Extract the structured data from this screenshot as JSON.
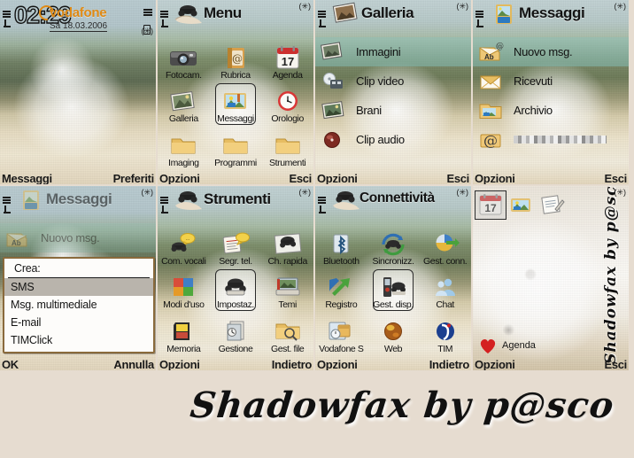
{
  "theme": {
    "name": "Shadowfax",
    "author_signature": "Shadowfax by p@sco",
    "accent_hex": "#8a6a3c",
    "highlight_hex": "#8fb3a5",
    "operator_hex": "#e08a14"
  },
  "panels": [
    {
      "id": "idle-home",
      "kind": "idle",
      "status": {
        "clock": "02:29",
        "operator": "vodafone",
        "date": "Sa 18.03.2006",
        "bluetooth_icon": "(✳)",
        "signal_icon": "signal-bars-icon",
        "battery_icon": "battery-icon"
      },
      "softkeys": {
        "left": "Messaggi",
        "right": "Preferiti"
      }
    },
    {
      "id": "menu",
      "kind": "grid",
      "title": "Menu",
      "title_icon": "phone-in-hand-icon",
      "bluetooth_icon": "(✳)",
      "items": [
        {
          "label": "Fotocam.",
          "icon": "camera-icon",
          "selected": false
        },
        {
          "label": "Rubrica",
          "icon": "contacts-icon",
          "selected": false
        },
        {
          "label": "Agenda",
          "icon": "calendar-17-icon",
          "selected": false
        },
        {
          "label": "Galleria",
          "icon": "gallery-icon",
          "selected": false
        },
        {
          "label": "Messaggi",
          "icon": "messages-icon",
          "selected": true
        },
        {
          "label": "Orologio",
          "icon": "clock-icon",
          "selected": false
        },
        {
          "label": "Imaging",
          "icon": "folder-icon",
          "selected": false
        },
        {
          "label": "Programmi",
          "icon": "folder-icon",
          "selected": false
        },
        {
          "label": "Strumenti",
          "icon": "folder-icon",
          "selected": false
        }
      ],
      "softkeys": {
        "left": "Opzioni",
        "right": "Esci"
      }
    },
    {
      "id": "galleria",
      "kind": "list",
      "title": "Galleria",
      "title_icon": "gallery-icon",
      "bluetooth_icon": "(✳)",
      "items": [
        {
          "label": "Immagini",
          "icon": "images-icon",
          "selected": true,
          "blurred": false
        },
        {
          "label": "Clip video",
          "icon": "video-clip-icon",
          "selected": false,
          "blurred": false
        },
        {
          "label": "Brani",
          "icon": "music-track-icon",
          "selected": false,
          "blurred": false
        },
        {
          "label": "Clip audio",
          "icon": "audio-clip-icon",
          "selected": false,
          "blurred": false
        }
      ],
      "softkeys": {
        "left": "Opzioni",
        "right": "Esci"
      }
    },
    {
      "id": "messaggi",
      "kind": "list",
      "title": "Messaggi",
      "title_icon": "messages-icon",
      "bluetooth_icon": "(✳)",
      "items": [
        {
          "label": "Nuovo msg.",
          "icon": "new-message-icon",
          "selected": true,
          "blurred": false
        },
        {
          "label": "Ricevuti",
          "icon": "inbox-icon",
          "selected": false,
          "blurred": false
        },
        {
          "label": "Archivio",
          "icon": "archive-icon",
          "selected": false,
          "blurred": false
        },
        {
          "label": "",
          "icon": "email-icon",
          "selected": false,
          "blurred": true
        }
      ],
      "softkeys": {
        "left": "Opzioni",
        "right": "Esci"
      }
    },
    {
      "id": "messaggi-popup",
      "kind": "list-with-popup",
      "title": "Messaggi",
      "title_icon": "messages-icon",
      "bluetooth_icon": "(✳)",
      "items": [
        {
          "label": "Nuovo msg.",
          "icon": "new-message-icon",
          "selected": true,
          "blurred": false
        }
      ],
      "popup": {
        "title": "Crea:",
        "options": [
          {
            "label": "SMS",
            "selected": true
          },
          {
            "label": "Msg. multimediale",
            "selected": false
          },
          {
            "label": "E-mail",
            "selected": false
          },
          {
            "label": "TIMClick",
            "selected": false
          }
        ]
      },
      "softkeys": {
        "left": "OK",
        "right": "Annulla"
      }
    },
    {
      "id": "strumenti",
      "kind": "grid",
      "title": "Strumenti",
      "title_icon": "phone-in-hand-icon",
      "bluetooth_icon": "(✳)",
      "items": [
        {
          "label": "Com. vocali",
          "icon": "voice-command-icon",
          "selected": false
        },
        {
          "label": "Segr. tel.",
          "icon": "voice-mailbox-icon",
          "selected": false
        },
        {
          "label": "Ch. rapida",
          "icon": "speed-dial-icon",
          "selected": false
        },
        {
          "label": "Modi d'uso",
          "icon": "profiles-icon",
          "selected": false
        },
        {
          "label": "Impostaz.",
          "icon": "settings-icon",
          "selected": true
        },
        {
          "label": "Temi",
          "icon": "themes-icon",
          "selected": false
        },
        {
          "label": "Memoria",
          "icon": "memory-card-icon",
          "selected": false
        },
        {
          "label": "Gestione",
          "icon": "app-manager-icon",
          "selected": false
        },
        {
          "label": "Gest. file",
          "icon": "file-manager-icon",
          "selected": false
        }
      ],
      "softkeys": {
        "left": "Opzioni",
        "right": "Indietro"
      }
    },
    {
      "id": "connettivita",
      "kind": "grid",
      "title": "Connettività",
      "title_icon": "phone-in-hand-icon",
      "bluetooth_icon": "(✳)",
      "items": [
        {
          "label": "Bluetooth",
          "icon": "bluetooth-icon",
          "selected": false
        },
        {
          "label": "Sincronizz.",
          "icon": "sync-icon",
          "selected": false
        },
        {
          "label": "Gest. conn.",
          "icon": "conn-manager-icon",
          "selected": false
        },
        {
          "label": "Registro",
          "icon": "log-icon",
          "selected": false
        },
        {
          "label": "Gest. disp.",
          "icon": "device-manager-icon",
          "selected": true
        },
        {
          "label": "Chat",
          "icon": "chat-icon",
          "selected": false
        },
        {
          "label": "Vodafone S",
          "icon": "vodafone-sim-icon",
          "selected": false
        },
        {
          "label": "Web",
          "icon": "web-icon",
          "selected": false
        },
        {
          "label": "TIM",
          "icon": "tim-icon",
          "selected": false
        }
      ],
      "softkeys": {
        "left": "Opzioni",
        "right": "Indietro"
      }
    },
    {
      "id": "idle-shortcuts",
      "kind": "idle-shortcuts",
      "bluetooth_icon": "(✳)",
      "shortcuts": [
        {
          "icon": "calendar-17-icon",
          "selected": true
        },
        {
          "icon": "messages-icon",
          "selected": false
        },
        {
          "icon": "notes-icon",
          "selected": false
        }
      ],
      "favourite": {
        "icon": "heart-icon",
        "label": "Agenda"
      },
      "watermark": "Shadowfax by p@sco",
      "softkeys": {
        "left": "Opzioni",
        "right": "Esci"
      }
    }
  ]
}
